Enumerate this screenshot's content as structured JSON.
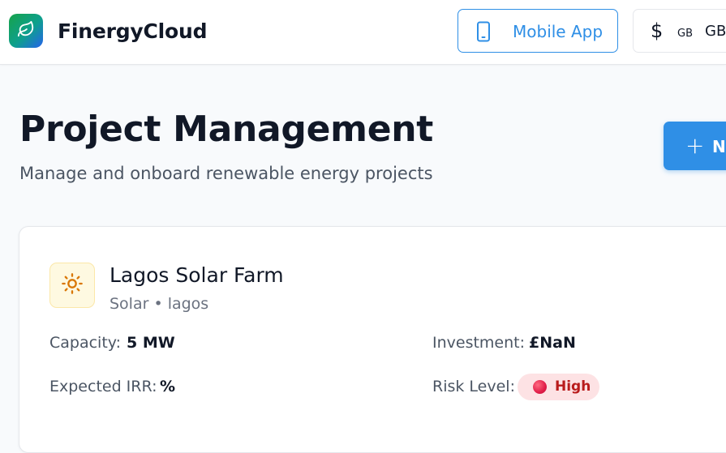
{
  "app": {
    "brand": "FinergyCloud",
    "logo_icon": "leaf-icon",
    "accent_color": "#2f8fe6"
  },
  "header": {
    "mobile_app_label": "Mobile App",
    "mobile_app_icon": "smartphone-icon",
    "currency_symbol": "$",
    "currency_code_small": "GB",
    "currency_code": "GB"
  },
  "page": {
    "title": "Project Management",
    "subtitle": "Manage and onboard renewable energy projects",
    "new_button_symbol": "+",
    "new_button_label": "N"
  },
  "project": {
    "icon": "sun-icon",
    "name": "Lagos Solar Farm",
    "meta": "Solar • lagos",
    "capacity_label": "Capacity:",
    "capacity_value": "5 MW",
    "investment_label": "Investment:",
    "investment_value": "£NaN",
    "irr_label": "Expected IRR:",
    "irr_value": "%",
    "risk_label": "Risk Level:",
    "risk_value": "High",
    "risk_color": "#e11d48"
  }
}
